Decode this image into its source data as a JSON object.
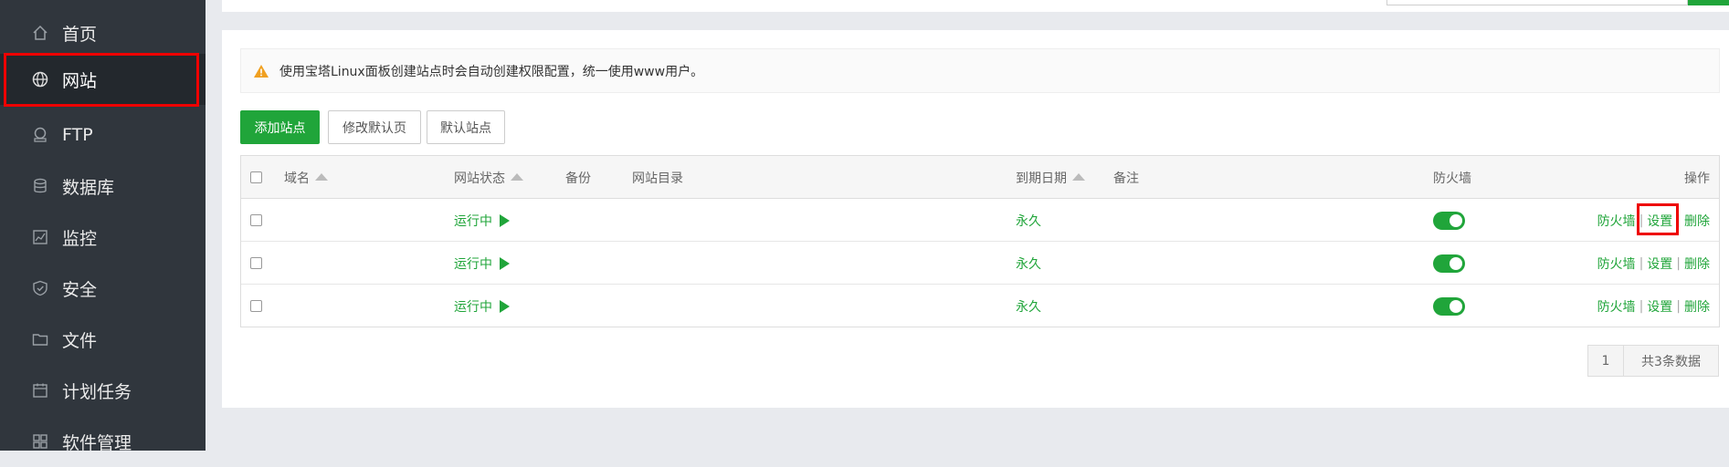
{
  "sidebar": {
    "items": [
      {
        "label": "首页",
        "icon": "home-icon"
      },
      {
        "label": "网站",
        "icon": "globe-icon",
        "active": true
      },
      {
        "label": "FTP",
        "icon": "ftp-icon"
      },
      {
        "label": "数据库",
        "icon": "database-icon"
      },
      {
        "label": "监控",
        "icon": "monitor-icon"
      },
      {
        "label": "安全",
        "icon": "shield-icon"
      },
      {
        "label": "文件",
        "icon": "folder-icon"
      },
      {
        "label": "计划任务",
        "icon": "calendar-icon"
      },
      {
        "label": "软件管理",
        "icon": "grid-icon"
      }
    ]
  },
  "notice": {
    "text": "使用宝塔Linux面板创建站点时会自动创建权限配置，统一使用www用户。",
    "icon": "warning-icon"
  },
  "toolbar": {
    "add_site": "添加站点",
    "modify_default_page": "修改默认页",
    "default_site": "默认站点"
  },
  "table": {
    "headers": {
      "domain": "域名",
      "status": "网站状态",
      "backup": "备份",
      "directory": "网站目录",
      "expire": "到期日期",
      "remark": "备注",
      "firewall": "防火墙",
      "actions": "操作"
    },
    "rows": [
      {
        "domain": "",
        "status": "运行中",
        "backup": "",
        "directory": "",
        "expire": "永久",
        "remark": "",
        "firewall_on": true,
        "actions": [
          "防火墙",
          "设置",
          "删除"
        ]
      },
      {
        "domain": "",
        "status": "运行中",
        "backup": "",
        "directory": "",
        "expire": "永久",
        "remark": "",
        "firewall_on": true,
        "actions": [
          "防火墙",
          "设置",
          "删除"
        ]
      },
      {
        "domain": "",
        "status": "运行中",
        "backup": "",
        "directory": "",
        "expire": "永久",
        "remark": "",
        "firewall_on": true,
        "actions": [
          "防火墙",
          "设置",
          "删除"
        ]
      }
    ]
  },
  "pagination": {
    "current_page": "1",
    "total": "共3条数据"
  },
  "colors": {
    "accent": "#20a53a",
    "sidebar_bg": "#30363d",
    "highlight": "#e00000"
  }
}
